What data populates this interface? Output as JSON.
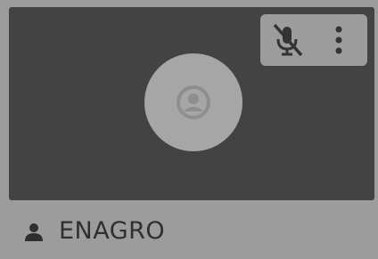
{
  "participant": {
    "name": "ENAGRO",
    "muted": true
  },
  "icons": {
    "mic": "mic-muted-icon",
    "more": "more-vertical-icon",
    "avatar": "person-avatar-icon",
    "name_prefix": "person-icon"
  },
  "colors": {
    "tile_background": "#9c9c9c",
    "video_background": "#434343",
    "avatar_circle": "#a6a6a6",
    "icon_dark": "#333333",
    "name_text": "#2f2f2f"
  }
}
